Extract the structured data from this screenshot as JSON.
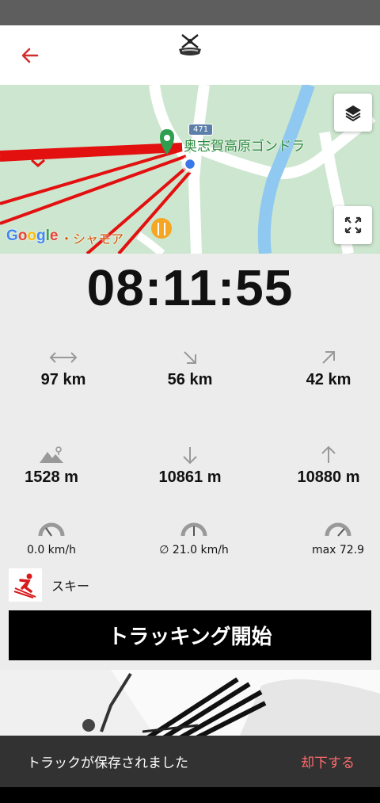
{
  "map": {
    "place_label": "奥志賀高原ゴンドラ",
    "place_label_2": "・シャモア",
    "road_number": "471",
    "google": "Google"
  },
  "timer": "08:11:55",
  "stats_row1": [
    {
      "icon": "horizontal-arrows-icon",
      "value": "97 km"
    },
    {
      "icon": "down-right-arrow-icon",
      "value": "56 km"
    },
    {
      "icon": "up-right-arrow-icon",
      "value": "42 km"
    }
  ],
  "stats_row2": [
    {
      "icon": "mountain-altitude-icon",
      "value": "1528 m"
    },
    {
      "icon": "down-arrow-icon",
      "value": "10861 m"
    },
    {
      "icon": "up-arrow-icon",
      "value": "10880 m"
    }
  ],
  "stats_row3": [
    {
      "icon": "speedometer-icon",
      "value": "0.0 km/h"
    },
    {
      "icon": "speedometer-avg-icon",
      "value": "∅ 21.0 km/h"
    },
    {
      "icon": "speedometer-max-icon",
      "value": "max 72.9"
    }
  ],
  "activity": {
    "label": "スキー",
    "icon": "skier-icon"
  },
  "start_button": "トラッキング開始",
  "snackbar": {
    "message": "トラックが保存されました",
    "action": "却下する"
  },
  "colors": {
    "accent_red": "#e21b1b",
    "snack_bg": "#323232",
    "snack_action": "#ff6b6b"
  }
}
